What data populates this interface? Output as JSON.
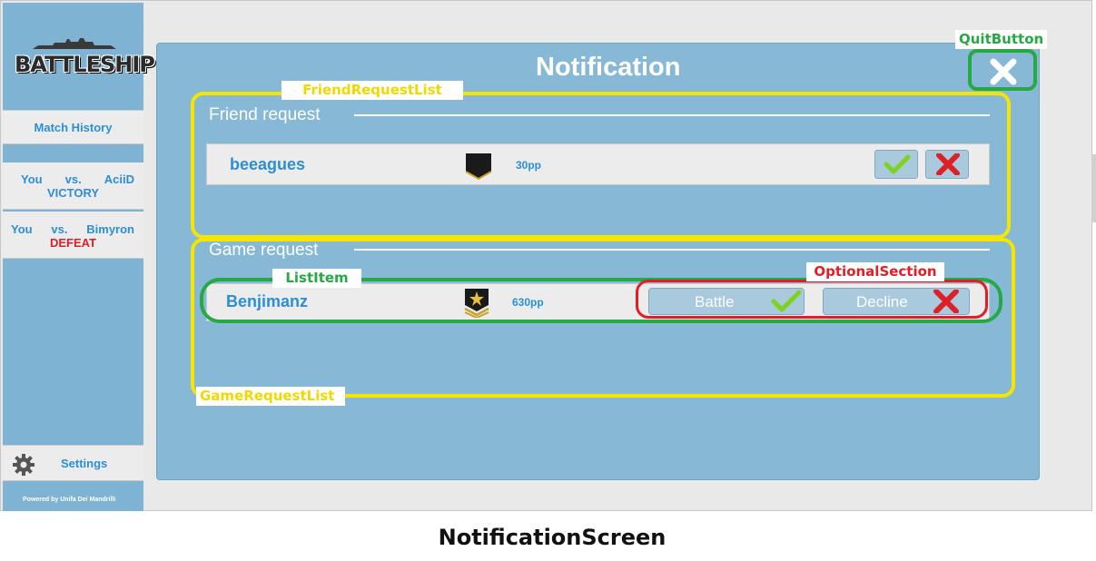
{
  "sidebar": {
    "logo_text": "BATTLESHIP",
    "match_history_label": "Match History",
    "history": [
      {
        "you": "You",
        "vs": "vs.",
        "opponent": "AciiD",
        "result": "VICTORY"
      },
      {
        "you": "You",
        "vs": "vs.",
        "opponent": "Bimyron",
        "result": "DEFEAT"
      }
    ],
    "settings_label": "Settings",
    "powered_by": "Powered by Unifa Dei Mandrilli"
  },
  "main": {
    "title": "Notification",
    "friend_request": {
      "section_title": "Friend request",
      "items": [
        {
          "name": "beeagues",
          "points": "30pp",
          "rank_icon": "rank-chevron-icon"
        }
      ]
    },
    "game_request": {
      "section_title": "Game request",
      "items": [
        {
          "name": "Benjimanz",
          "points": "630pp",
          "rank_icon": "rank-star-sergeant-icon",
          "battle_label": "Battle",
          "decline_label": "Decline"
        }
      ]
    }
  },
  "annotations": {
    "quit_button": "QuitButton",
    "friend_request_list": "FriendRequestList",
    "game_request_list": "GameRequestList",
    "list_item": "ListItem",
    "optional_section": "OptionalSection"
  },
  "caption": "NotificationScreen",
  "colors": {
    "sidebar_bg": "#7eb3d3",
    "panel_bg": "#87b9d6",
    "text_blue": "#2a8fd6",
    "defeat_red": "#d8202a",
    "annotation_yellow": "#f5e500",
    "annotation_green": "#26a844",
    "annotation_red": "#e01e26"
  }
}
